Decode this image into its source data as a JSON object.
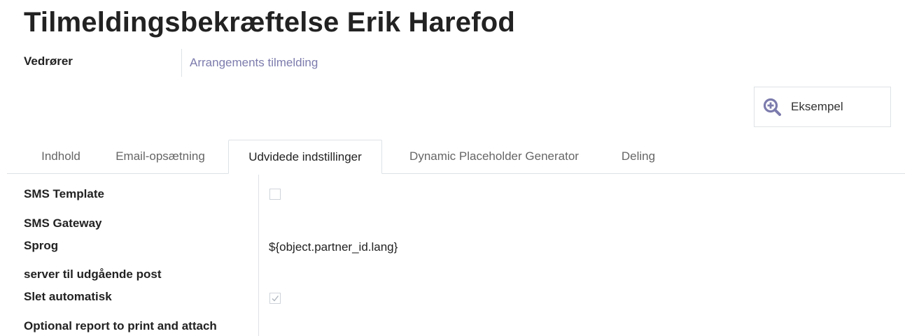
{
  "page": {
    "title": "Tilmeldingsbekræftelse Erik Harefod"
  },
  "relates_to": {
    "label": "Vedrører",
    "value": "Arrangements tilmelding"
  },
  "preview_button": {
    "label": "Eksempel",
    "icon": "zoom-in-icon",
    "icon_color": "#7c7bad"
  },
  "tabs": [
    {
      "label": "Indhold",
      "active": false
    },
    {
      "label": "Email-opsætning",
      "active": false
    },
    {
      "label": "Udvidede indstillinger",
      "active": true
    },
    {
      "label": "Dynamic Placeholder Generator",
      "active": false
    },
    {
      "label": "Deling",
      "active": false
    }
  ],
  "fields": {
    "sms_template": {
      "label": "SMS Template",
      "checked": false
    },
    "sms_gateway": {
      "label": "SMS Gateway",
      "value": ""
    },
    "language": {
      "label": "Sprog",
      "value": "${object.partner_id.lang}"
    },
    "mail_server": {
      "label": "server til udgående post",
      "value": ""
    },
    "auto_delete": {
      "label": "Slet automatisk",
      "checked": true
    },
    "report": {
      "label": "Optional report to print and attach",
      "value": ""
    }
  },
  "colors": {
    "link": "#7c7bad",
    "border": "#dee2e6"
  }
}
